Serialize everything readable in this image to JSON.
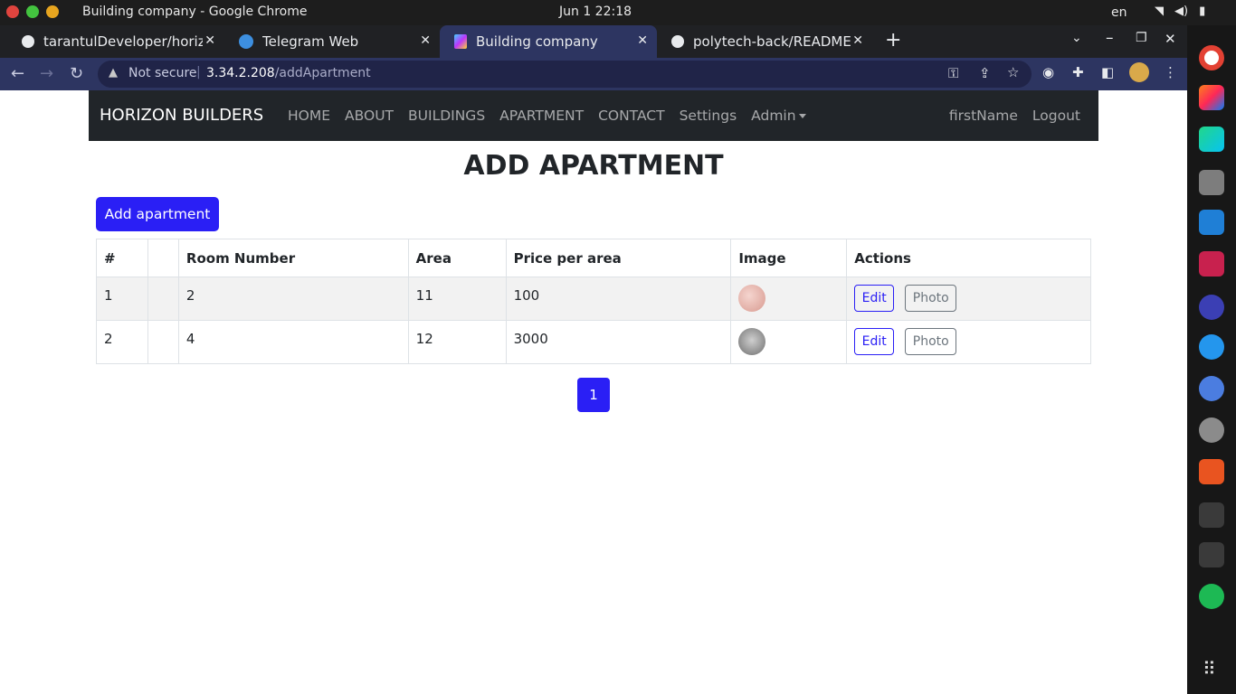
{
  "os": {
    "window_title": "Building company - Google Chrome",
    "clock": "Jun 1  22:18",
    "lang": "en",
    "tray_icons": [
      "wifi-icon",
      "volume-icon",
      "battery-icon"
    ]
  },
  "browser": {
    "tabs": [
      {
        "title": "tarantulDeveloper/horizo",
        "favicon": "github-icon"
      },
      {
        "title": "Telegram Web",
        "favicon": "telegram-icon"
      },
      {
        "title": "Building company",
        "favicon": "vite-icon",
        "active": true
      },
      {
        "title": "polytech-back/README.m",
        "favicon": "github-icon"
      }
    ],
    "security": "Not secure",
    "url_host": "3.34.2.208",
    "url_path": "/addApartment"
  },
  "site": {
    "brand": "HORIZON BUILDERS",
    "nav": [
      "HOME",
      "ABOUT",
      "BUILDINGS",
      "APARTMENT",
      "CONTACT",
      "Settings",
      "Admin"
    ],
    "user": "firstName",
    "logout": "Logout",
    "heading": "ADD APARTMENT",
    "add_button": "Add apartment",
    "table": {
      "headers": [
        "#",
        "",
        "Room Number",
        "Area",
        "Price per area",
        "Image",
        "Actions"
      ],
      "rows": [
        {
          "num": "1",
          "blank": "",
          "room": "2",
          "area": "11",
          "price": "100",
          "image": "apartment-thumbnail-1",
          "edit": "Edit",
          "photo": "Photo"
        },
        {
          "num": "2",
          "blank": "",
          "room": "4",
          "area": "12",
          "price": "3000",
          "image": "apartment-thumbnail-2",
          "edit": "Edit",
          "photo": "Photo"
        }
      ]
    },
    "page": "1"
  },
  "colors": {
    "primary": "#2a1ff5",
    "navbar": "#212529",
    "chrome_accent": "#2d3561"
  }
}
